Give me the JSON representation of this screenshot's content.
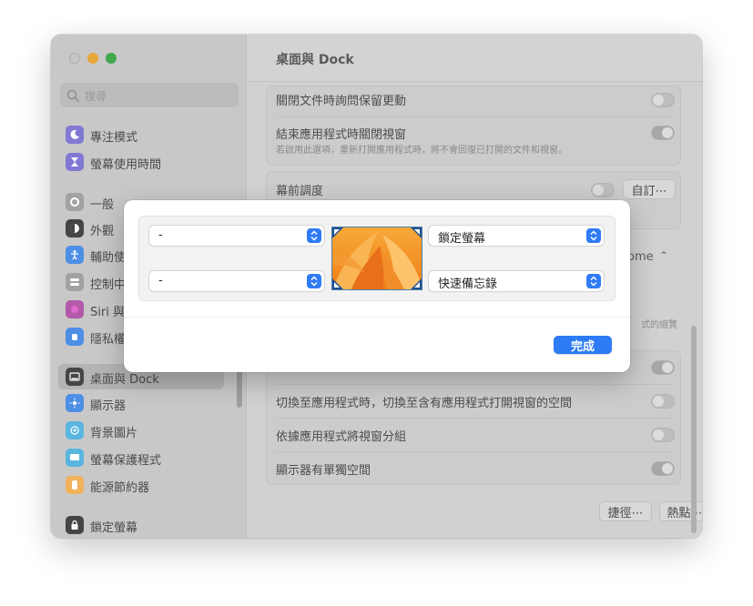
{
  "sidebar": {
    "search_placeholder": "搜尋",
    "items": [
      {
        "label": "專注模式",
        "icon": "moon-icon",
        "color": "#6b62c9"
      },
      {
        "label": "螢幕使用時間",
        "icon": "hourglass-icon",
        "color": "#6b62c9"
      },
      {
        "label": "一般",
        "icon": "gear-icon",
        "color": "#8e8d8d"
      },
      {
        "label": "外觀",
        "icon": "appearance-icon",
        "color": "#262626"
      },
      {
        "label": "輔助使",
        "icon": "accessibility-icon",
        "color": "#2f7bf6"
      },
      {
        "label": "控制中",
        "icon": "control-center-icon",
        "color": "#8e8d8d"
      },
      {
        "label": "Siri 與",
        "icon": "siri-icon",
        "color": "#c13c9c"
      },
      {
        "label": "隱私權",
        "icon": "hand-icon",
        "color": "#2f7bf6"
      },
      {
        "label": "桌面與 Dock",
        "icon": "dock-icon",
        "color": "#262626"
      },
      {
        "label": "顯示器",
        "icon": "display-icon",
        "color": "#2f7bf6"
      },
      {
        "label": "背景圖片",
        "icon": "wallpaper-icon",
        "color": "#34aadc"
      },
      {
        "label": "螢幕保護程式",
        "icon": "screensaver-icon",
        "color": "#34aadc"
      },
      {
        "label": "能源節約器",
        "icon": "battery-icon",
        "color": "#f2a93b"
      },
      {
        "label": "鎖定螢幕",
        "icon": "lock-icon",
        "color": "#262626"
      }
    ]
  },
  "main": {
    "title": "桌面與 Dock",
    "rows": {
      "close_docs": "關閉文件時詢問保留更動",
      "quit_apps": "結束應用程式時關閉視窗",
      "quit_apps_sub": "若啟用此選項，重新打開應用程式時，將不會回復已打開的文件和視窗。",
      "stage_manager": "幕前調度",
      "stage_button": "自訂⋯",
      "browser_tail": "rome",
      "partial_tail": "式的縮覽",
      "switch_space": "切換至應用程式時，切換至含有應用程式打開視窗的空間",
      "group_windows": "依據應用程式將視窗分組",
      "separate_spaces": "顯示器有單獨空間",
      "shortcuts_button": "捷徑⋯",
      "hot_corners_button": "熱點⋯",
      "help_button": "?"
    }
  },
  "modal": {
    "top_left": "-",
    "top_right": "鎖定螢幕",
    "bottom_left": "-",
    "bottom_right": "快速備忘錄",
    "done_label": "完成"
  }
}
